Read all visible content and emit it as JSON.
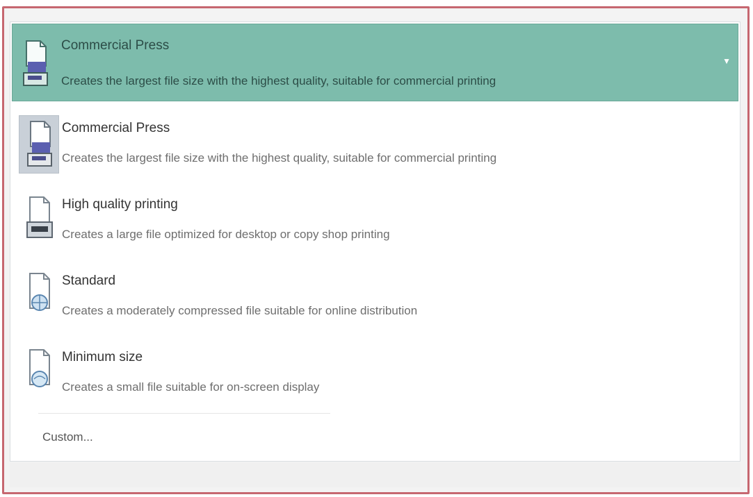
{
  "top_caption": "",
  "selected": {
    "title": "Commercial Press",
    "description": "Creates the largest file size with the highest quality, suitable for commercial printing",
    "arrow_icon": "chevron-down-icon",
    "icon": "document-press-icon"
  },
  "items": [
    {
      "title": "Commercial Press",
      "description": "Creates the largest file size with the highest quality, suitable for commercial printing",
      "icon": "document-press-icon"
    },
    {
      "title": "High quality printing",
      "description": "Creates a large file optimized for desktop or copy shop printing",
      "icon": "document-printer-icon"
    },
    {
      "title": "Standard",
      "description": "Creates a moderately compressed file suitable for online distribution",
      "icon": "document-globe-icon"
    },
    {
      "title": "Minimum size",
      "description": "Creates a small file suitable for on-screen display",
      "icon": "document-screen-icon"
    }
  ],
  "custom_label": "Custom...",
  "colors": {
    "frame_border": "#c66770",
    "selected_background": "#7dbcac",
    "highlight_icon_background": "#c9d0d8"
  }
}
